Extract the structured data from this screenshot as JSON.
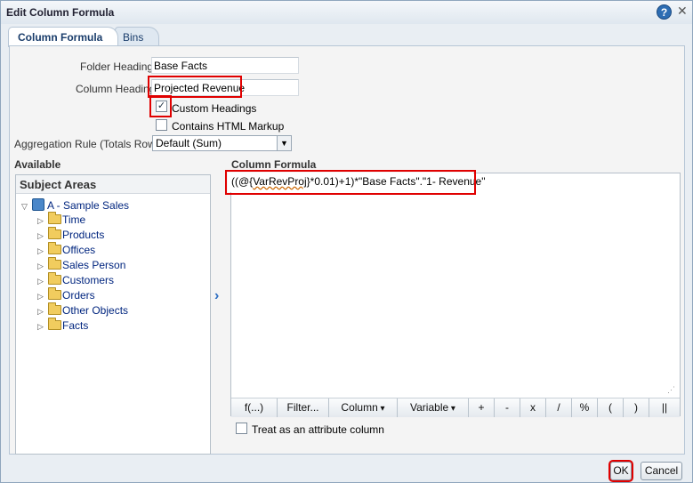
{
  "dialog": {
    "title": "Edit Column Formula",
    "help_symbol": "?",
    "close_symbol": "✕"
  },
  "tabs": [
    {
      "label": "Column Formula"
    },
    {
      "label": "Bins"
    }
  ],
  "form": {
    "folder_heading_label": "Folder Heading",
    "folder_heading_value": "Base Facts",
    "column_heading_label": "Column Heading",
    "column_heading_value": "Projected Revenue",
    "custom_headings_label": "Custom Headings",
    "custom_headings_checked": true,
    "contains_html_label": "Contains HTML Markup",
    "contains_html_checked": false,
    "aggregation_label": "Aggregation Rule (Totals Row)",
    "aggregation_value": "Default (Sum)"
  },
  "available": {
    "heading": "Available",
    "panel_title": "Subject Areas",
    "root": "A - Sample Sales",
    "folders": [
      "Time",
      "Products",
      "Offices",
      "Sales Person",
      "Customers",
      "Orders",
      "Other Objects",
      "Facts"
    ]
  },
  "formula": {
    "heading": "Column Formula",
    "prefix": "((@{",
    "variable": "VarRevProj",
    "suffix": "}*0.01)+1)*\"Base Facts\".\"1- Revenue\"",
    "toolbar": [
      "f(...)",
      "Filter...",
      "Column",
      "Variable",
      "+",
      "-",
      "x",
      "/",
      "%",
      "(",
      ")",
      "||"
    ]
  },
  "attribute_column_label": "Treat as an attribute column",
  "buttons": {
    "ok": "OK",
    "cancel": "Cancel"
  },
  "colors": {
    "accent": "#1a3d6b",
    "highlight": "#e00000"
  }
}
